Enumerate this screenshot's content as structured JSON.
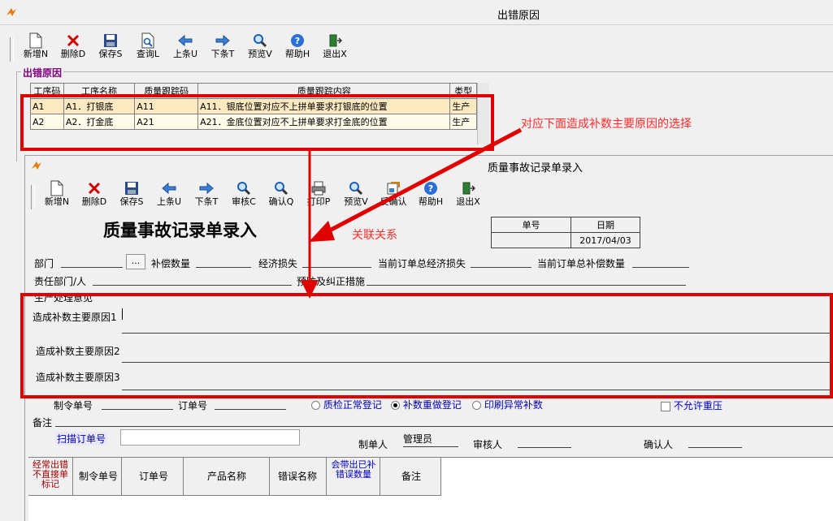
{
  "window": {
    "title": "出错原因"
  },
  "toolbar1": [
    {
      "label": "新增N",
      "icon": "new-doc-icon"
    },
    {
      "label": "删除D",
      "icon": "delete-x-icon"
    },
    {
      "label": "保存S",
      "icon": "save-disk-icon"
    },
    {
      "label": "查询L",
      "icon": "search-doc-icon"
    },
    {
      "label": "上条U",
      "icon": "arrow-left-icon"
    },
    {
      "label": "下条T",
      "icon": "arrow-right-icon"
    },
    {
      "label": "预览V",
      "icon": "magnifier-icon"
    },
    {
      "label": "帮助H",
      "icon": "help-icon"
    },
    {
      "label": "退出X",
      "icon": "exit-door-icon"
    }
  ],
  "group": {
    "title": "出错原因"
  },
  "grid1": {
    "headers": [
      "工序码",
      "工序名称",
      "质量跟踪码",
      "质量跟踪内容",
      "类型"
    ],
    "rows": [
      [
        "A1",
        "A1．打银底",
        "A11",
        "A11．银底位置对应不上拼单要求打银底的位置",
        "生产"
      ],
      [
        "A2",
        "A2．打金底",
        "A21",
        "A21．金底位置对应不上拼单要求打金底的位置",
        "生产"
      ]
    ]
  },
  "annotations": {
    "select_note": "对应下面造成补数主要原因的选择",
    "link_note": "关联关系"
  },
  "child": {
    "title": "质量事故记录单录入",
    "toolbar": [
      {
        "label": "新增N",
        "icon": "new-doc-icon"
      },
      {
        "label": "删除D",
        "icon": "delete-x-icon"
      },
      {
        "label": "保存S",
        "icon": "save-disk-icon"
      },
      {
        "label": "上条U",
        "icon": "arrow-left-icon"
      },
      {
        "label": "下条T",
        "icon": "arrow-right-icon"
      },
      {
        "label": "审核C",
        "icon": "magnifier-icon"
      },
      {
        "label": "确认Q",
        "icon": "magnifier-icon"
      },
      {
        "label": "打印P",
        "icon": "printer-icon"
      },
      {
        "label": "预览V",
        "icon": "magnifier-icon"
      },
      {
        "label": "反确认",
        "icon": "undo-confirm-icon"
      },
      {
        "label": "帮助H",
        "icon": "help-icon"
      },
      {
        "label": "退出X",
        "icon": "exit-door-icon"
      }
    ],
    "form_heading": "质量事故记录单录入",
    "doc_no_label": "单号",
    "date_label": "日期",
    "date_value": "2017/04/03",
    "dept_label": "部门",
    "browse_label": "...",
    "comp_qty_label": "补偿数量",
    "econ_loss_label": "经济损失",
    "total_loss_label": "当前订单总经济损失",
    "total_comp_label": "当前订单总补偿数量",
    "resp_dept_label": "责任部门/人",
    "prevent_label": "预防及纠正措施",
    "process_label": "生产处理意见",
    "reason1_label": "造成补数主要原因1",
    "reason2_label": "造成补数主要原因2",
    "reason3_label": "造成补数主要原因3",
    "make_no_label": "制令单号",
    "order_no_label": "订单号",
    "radio1": "质检正常登记",
    "radio2": "补数重做登记",
    "radio3": "印刷异常补数",
    "no_press_label": "不允许重压",
    "remark_label": "备注",
    "scan_label": "扫描订单号",
    "maker_label": "制单人",
    "maker_value": "管理员",
    "auditor_label": "审核人",
    "confirmer_label": "确认人",
    "bottom_headers": [
      "经常出错不直接单标记",
      "制令单号",
      "订单号",
      "产品名称",
      "错误名称",
      "会带出已补错误数量",
      "备注"
    ]
  }
}
